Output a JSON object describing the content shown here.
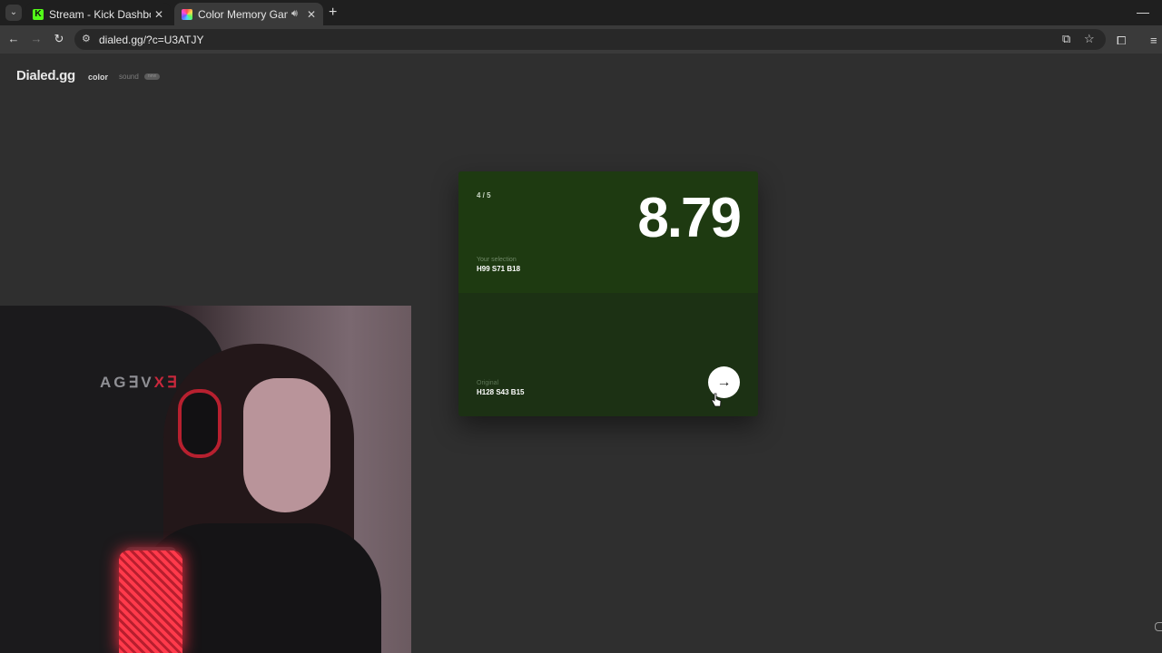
{
  "browser": {
    "tabs": [
      {
        "title": "Stream - Kick Dashboard",
        "favicon": "kick-icon",
        "active": false
      },
      {
        "title": "Color Memory Game — Ho",
        "favicon": "color-wheel-icon",
        "active": true
      }
    ],
    "address": {
      "url": "dialed.gg/?c=U3ATJY"
    }
  },
  "site": {
    "brand": "Dialed.gg",
    "nav": {
      "color": "color",
      "sound": "sound",
      "badge": "new"
    }
  },
  "result": {
    "progress": "4 / 5",
    "score": "8.79",
    "selection_label": "Your selection",
    "selection_value": "H99 S71 B18",
    "original_label": "Original",
    "original_value": "H128 S43 B15",
    "next_icon": "arrow-right-icon",
    "colors": {
      "selection": "#1e3a11",
      "original": "#1c3114"
    }
  },
  "webcam": {
    "chair_logo_left": "AG∃V",
    "chair_logo_red": "X∃"
  }
}
